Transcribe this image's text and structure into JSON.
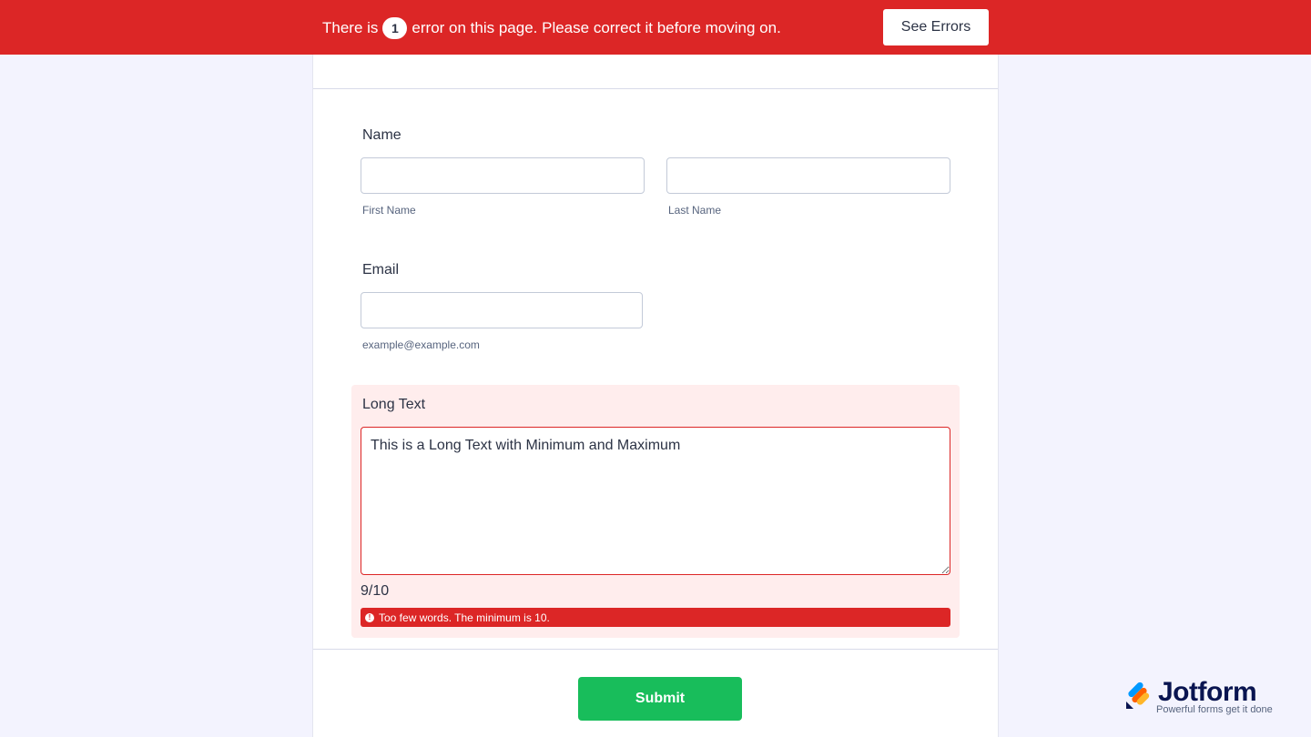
{
  "error_bar": {
    "prefix": "There is",
    "count": "1",
    "suffix": "error on this page. Please correct it before moving on.",
    "see_errors_label": "See Errors"
  },
  "form": {
    "name": {
      "label": "Name",
      "first": {
        "value": "",
        "sublabel": "First Name"
      },
      "last": {
        "value": "",
        "sublabel": "Last Name"
      }
    },
    "email": {
      "label": "Email",
      "value": "",
      "sublabel": "example@example.com"
    },
    "long_text": {
      "label": "Long Text",
      "value": "This is a Long Text with Minimum and Maximum",
      "word_count": "9/10",
      "error_message": "Too few words. The minimum is 10."
    },
    "submit_label": "Submit"
  },
  "branding": {
    "name": "Jotform",
    "tagline": "Powerful forms get it done"
  },
  "colors": {
    "error": "#dc2626",
    "error_bg": "#ffeded",
    "submit": "#18bd5b",
    "page_bg": "#f3f3fe"
  },
  "icons": [
    "alert-circle-icon",
    "jotform-logo-icon",
    "resize-handle-icon"
  ]
}
